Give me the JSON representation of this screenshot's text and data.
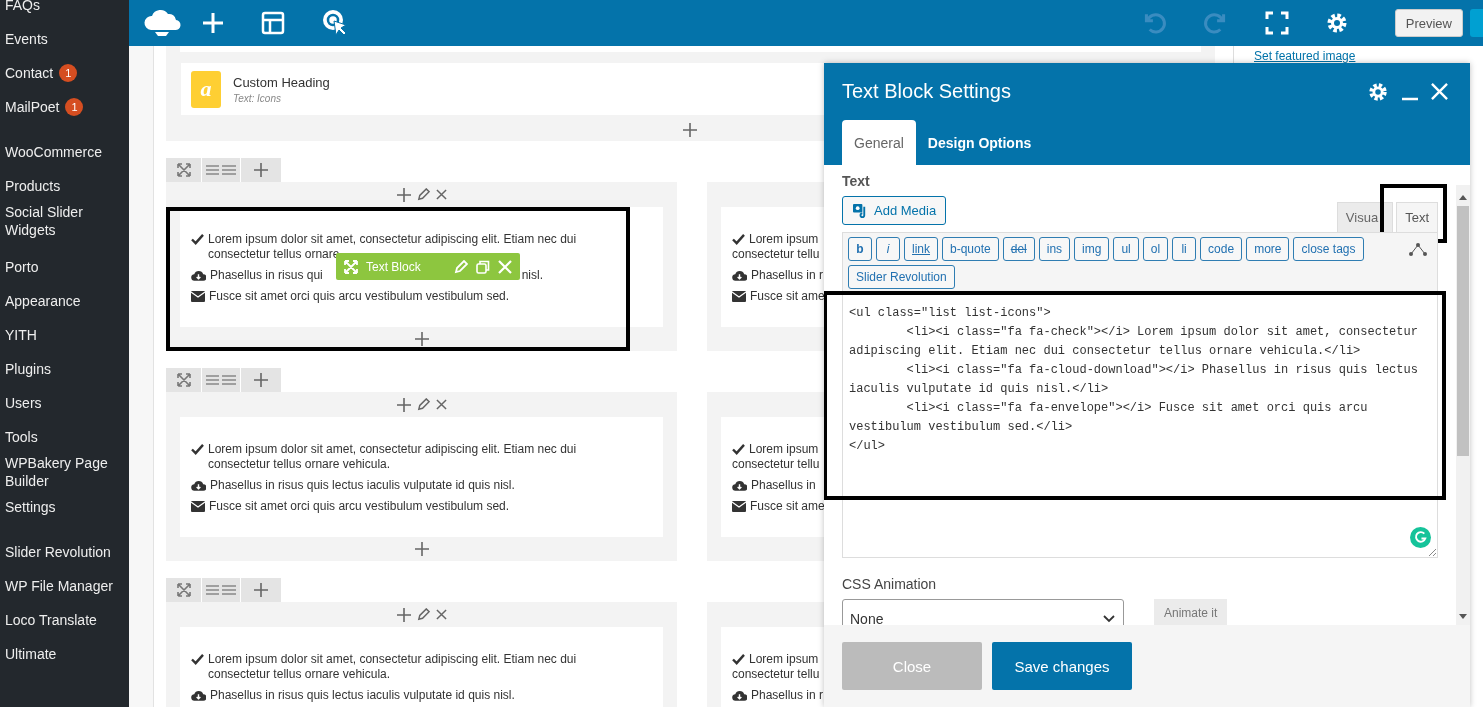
{
  "sidebar": {
    "groups": [
      {
        "items": [
          {
            "label": "FAQs"
          },
          {
            "label": "Events"
          },
          {
            "label": "Contact",
            "badge": "1"
          },
          {
            "label": "MailPoet",
            "badge": "1"
          }
        ]
      },
      {
        "items": [
          {
            "label": "WooCommerce"
          },
          {
            "label": "Products"
          },
          {
            "label": "Social Slider Widgets"
          }
        ]
      },
      {
        "items": [
          {
            "label": "Porto"
          },
          {
            "label": "Appearance"
          },
          {
            "label": "YITH"
          },
          {
            "label": "Plugins"
          },
          {
            "label": "Users"
          },
          {
            "label": "Tools"
          },
          {
            "label": "WPBakery Page Builder"
          },
          {
            "label": "Settings"
          }
        ]
      },
      {
        "items": [
          {
            "label": "Slider Revolution"
          },
          {
            "label": "WP File Manager"
          },
          {
            "label": "Loco Translate"
          },
          {
            "label": "Ultimate"
          }
        ]
      }
    ]
  },
  "topbar": {
    "preview": "Preview"
  },
  "featured_link": "Set featured image",
  "top_element": {
    "title": "Custom Heading",
    "subtitle": "Text: Icons",
    "icon_letter": "a"
  },
  "element_toolbar": {
    "label": "Text Block"
  },
  "rows": [
    {
      "columns": [
        {
          "controls": true,
          "active": true,
          "highlighted": true,
          "items": [
            {
              "kind": "check",
              "lines": [
                "Lorem ipsum dolor sit amet, consectetur adipiscing elit. Etiam nec dui consectetur tellus ornare"
              ]
            },
            {
              "kind": "cloud",
              "lines": [
                "Phasellus in risus qui"
              ],
              "end": "nisl."
            },
            {
              "kind": "envelope",
              "lines": [
                "Fusce sit amet orci quis arcu vestibulum vestibulum sed."
              ]
            }
          ]
        },
        {
          "highlighted": false,
          "items": [
            {
              "kind": "check",
              "lines": [
                "Lorem ipsum",
                "consectetur tellu"
              ]
            },
            {
              "kind": "cloud",
              "lines": [
                "Phasellus in r"
              ]
            },
            {
              "kind": "envelope",
              "lines": [
                "Fusce sit ame"
              ]
            }
          ]
        }
      ]
    },
    {
      "columns": [
        {
          "controls": true,
          "active": false,
          "highlighted": false,
          "items": [
            {
              "kind": "check",
              "lines": [
                "Lorem ipsum dolor sit amet, consectetur adipiscing elit. Etiam nec dui consectetur tellus ornare vehicula."
              ]
            },
            {
              "kind": "cloud",
              "lines": [
                "Phasellus in risus quis lectus iaculis vulputate id quis nisl."
              ]
            },
            {
              "kind": "envelope",
              "lines": [
                "Fusce sit amet orci quis arcu vestibulum vestibulum sed."
              ]
            }
          ]
        },
        {
          "highlighted": false,
          "items": [
            {
              "kind": "check",
              "lines": [
                "Lorem ipsum",
                "consectetur tellu"
              ]
            },
            {
              "kind": "cloud",
              "lines": [
                "Phasellus in"
              ]
            },
            {
              "kind": "envelope",
              "lines": [
                "Fusce sit ame"
              ]
            }
          ]
        }
      ]
    },
    {
      "columns": [
        {
          "controls": true,
          "active": false,
          "highlighted": false,
          "items": [
            {
              "kind": "check",
              "lines": [
                "Lorem ipsum dolor sit amet, consectetur adipiscing elit. Etiam nec dui consectetur tellus ornare vehicula."
              ]
            },
            {
              "kind": "cloud",
              "lines": [
                "Phasellus in risus quis lectus iaculis vulputate id quis nisl."
              ]
            }
          ]
        },
        {
          "highlighted": false,
          "items": [
            {
              "kind": "check",
              "lines": [
                "Lorem ipsum",
                "consectetur tellu"
              ]
            },
            {
              "kind": "cloud",
              "lines": [
                "Phasellus in r"
              ]
            }
          ]
        }
      ]
    }
  ],
  "modal": {
    "title": "Text Block Settings",
    "tabs": [
      {
        "label": "General",
        "selected": true
      },
      {
        "label": "Design Options",
        "selected": false
      }
    ],
    "field_label": "Text",
    "add_media": "Add Media",
    "editor_tabs": [
      {
        "label": "Visua",
        "selected": false,
        "highlighted": false
      },
      {
        "label": "Text",
        "selected": true,
        "highlighted": true
      }
    ],
    "quicktags": [
      {
        "label": "b",
        "kind": "bold"
      },
      {
        "label": "i",
        "kind": "italic"
      },
      {
        "label": "link",
        "kind": "underline"
      },
      {
        "label": "b-quote",
        "kind": "plain"
      },
      {
        "label": "del",
        "kind": "strike"
      },
      {
        "label": "ins",
        "kind": "plain"
      },
      {
        "label": "img",
        "kind": "plain"
      },
      {
        "label": "ul",
        "kind": "plain"
      },
      {
        "label": "ol",
        "kind": "plain"
      },
      {
        "label": "li",
        "kind": "plain"
      },
      {
        "label": "code",
        "kind": "plain"
      },
      {
        "label": "more",
        "kind": "plain"
      },
      {
        "label": "close tags",
        "kind": "plain"
      },
      {
        "label": "Slider Revolution",
        "kind": "plain"
      }
    ],
    "editor": {
      "highlighted": true,
      "code": "<ul class=\"list list-icons\">\n\t<li><i class=\"fa fa-check\"></i> Lorem ipsum dolor sit amet, consectetur adipiscing elit. Etiam nec dui consectetur tellus ornare vehicula.</li>\n\t<li><i class=\"fa fa-cloud-download\"></i> Phasellus in risus quis lectus iaculis vulputate id quis nisl.</li>\n\t<li><i class=\"fa fa-envelope\"></i> Fusce sit amet orci quis arcu vestibulum vestibulum sed.</li>\n</ul>"
    },
    "animation": {
      "label": "CSS Animation",
      "value": "None",
      "button": "Animate it"
    },
    "buttons": [
      {
        "label": "Close",
        "kind": "secondary"
      },
      {
        "label": "Save changes",
        "kind": "primary"
      }
    ]
  }
}
